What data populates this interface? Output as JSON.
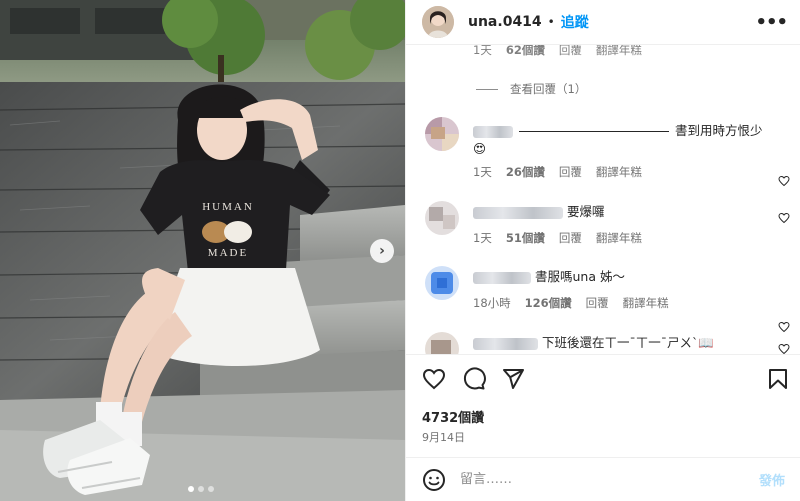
{
  "post": {
    "username": "una.0414",
    "follow_label": "追蹤",
    "likes": "4732個讚",
    "date": "9月14日"
  },
  "comments_section": {
    "top_meta": {
      "time": "1天",
      "likes": "62個讚",
      "reply": "回覆",
      "translate": "翻譯年糕"
    },
    "view_replies": "查看回覆（1）",
    "items": [
      {
        "text": "書到用時方恨少",
        "emoji": "😍",
        "time": "1天",
        "likes": "26個讚",
        "reply": "回覆",
        "translate": "翻譯年糕"
      },
      {
        "text": "要爆囉",
        "time": "1天",
        "likes": "51個讚",
        "reply": "回覆",
        "translate": "翻譯年糕"
      },
      {
        "text": "書服嗎una 姊～",
        "time": "18小時",
        "likes": "126個讚",
        "reply": "回覆",
        "translate": "翻譯年糕"
      },
      {
        "text": "下班後還在ㄒ一ˉㄒ一ˉㄕㄨˋ📖"
      }
    ]
  },
  "compose": {
    "placeholder": "留言……",
    "post_label": "發佈"
  },
  "icons": {
    "heart": "heart-icon",
    "comment": "comment-icon",
    "share": "paper-plane-icon",
    "save": "bookmark-icon",
    "emoji": "smiley-icon",
    "more": "more-horizontal-icon",
    "next": "chevron-right-icon"
  },
  "carousel": {
    "slides": 3,
    "active": 1
  },
  "colors": {
    "accent": "#0095f6",
    "text": "#262626",
    "muted": "#737373",
    "post_disabled": "#b2dffc"
  }
}
